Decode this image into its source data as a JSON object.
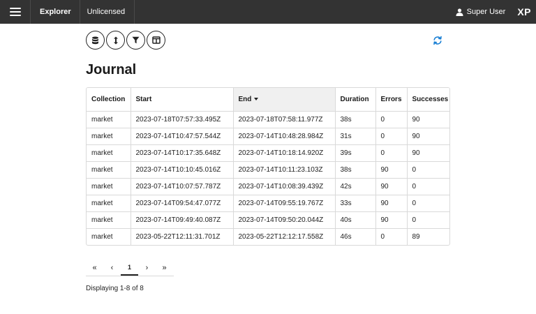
{
  "topbar": {
    "app_name": "Explorer",
    "license": "Unlicensed",
    "user": "Super User",
    "logo": "XP",
    "menu_icon": "hamburger-menu-icon",
    "user_icon": "user-icon",
    "background": "#333333"
  },
  "toolbar": {
    "buttons": [
      {
        "icon": "database-icon"
      },
      {
        "icon": "sort-arrows-icon"
      },
      {
        "icon": "filter-icon"
      },
      {
        "icon": "columns-icon"
      }
    ],
    "refresh_icon": "refresh-icon",
    "refresh_color": "#1a7fd4"
  },
  "page": {
    "title": "Journal"
  },
  "table": {
    "columns": [
      "Collection",
      "Start",
      "End",
      "Duration",
      "Errors",
      "Successes"
    ],
    "sorted_column": "End",
    "rows": [
      [
        "market",
        "2023-07-18T07:57:33.495Z",
        "2023-07-18T07:58:11.977Z",
        "38s",
        "0",
        "90"
      ],
      [
        "market",
        "2023-07-14T10:47:57.544Z",
        "2023-07-14T10:48:28.984Z",
        "31s",
        "0",
        "90"
      ],
      [
        "market",
        "2023-07-14T10:17:35.648Z",
        "2023-07-14T10:18:14.920Z",
        "39s",
        "0",
        "90"
      ],
      [
        "market",
        "2023-07-14T10:10:45.016Z",
        "2023-07-14T10:11:23.103Z",
        "38s",
        "90",
        "0"
      ],
      [
        "market",
        "2023-07-14T10:07:57.787Z",
        "2023-07-14T10:08:39.439Z",
        "42s",
        "90",
        "0"
      ],
      [
        "market",
        "2023-07-14T09:54:47.077Z",
        "2023-07-14T09:55:19.767Z",
        "33s",
        "90",
        "0"
      ],
      [
        "market",
        "2023-07-14T09:49:40.087Z",
        "2023-07-14T09:50:20.044Z",
        "40s",
        "90",
        "0"
      ],
      [
        "market",
        "2023-05-22T12:11:31.701Z",
        "2023-05-22T12:12:17.558Z",
        "46s",
        "0",
        "89"
      ]
    ]
  },
  "pagination": {
    "first": "«",
    "prev": "‹",
    "current": "1",
    "next": "›",
    "last": "»"
  },
  "status": {
    "displaying": "Displaying 1-8 of 8"
  }
}
